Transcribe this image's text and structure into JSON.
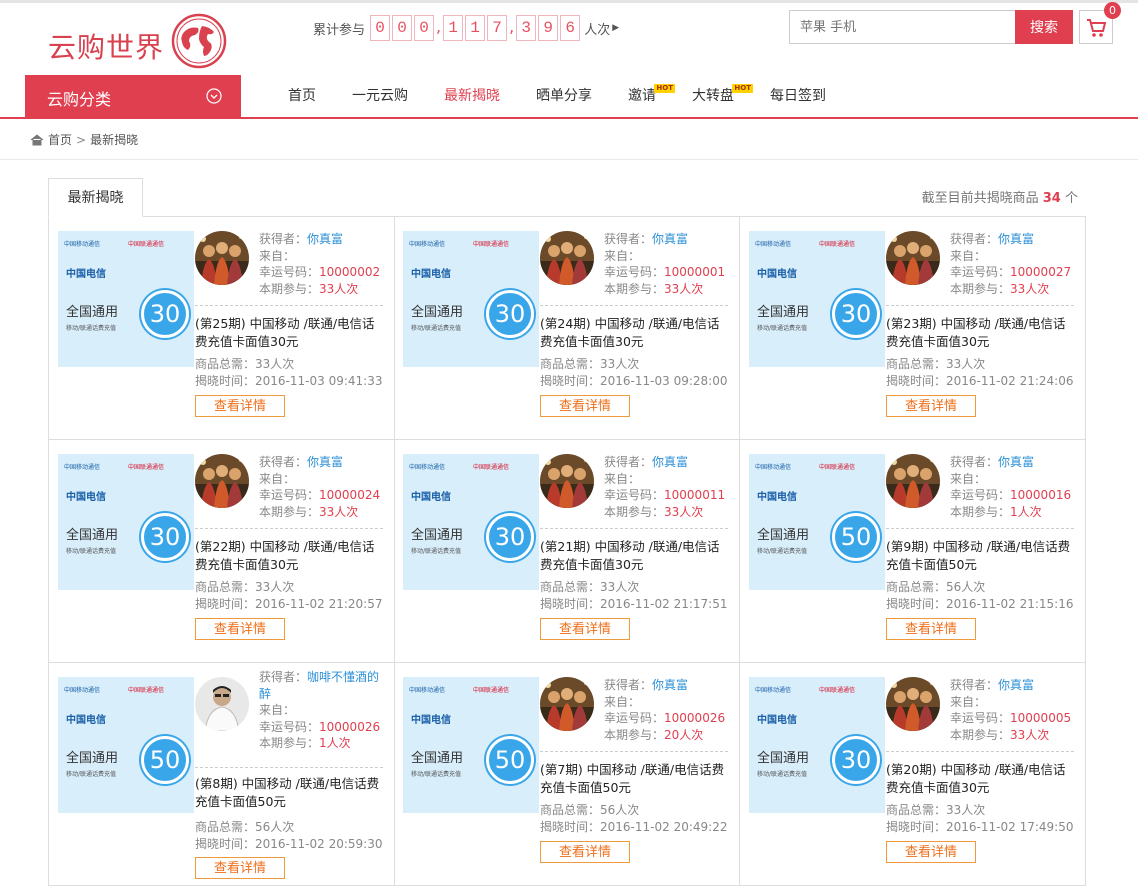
{
  "logo": {
    "text": "云购世界"
  },
  "counter": {
    "label": "累计参与",
    "digits": [
      "0",
      "0",
      "0",
      ",",
      "1",
      "1",
      "7",
      ",",
      "3",
      "9",
      "6"
    ],
    "unit": "人次"
  },
  "search": {
    "placeholder": "苹果 手机",
    "button": "搜索"
  },
  "cart": {
    "count": "0"
  },
  "category": {
    "label": "云购分类"
  },
  "nav": [
    {
      "label": "首页",
      "active": false,
      "hot": ""
    },
    {
      "label": "一元云购",
      "active": false,
      "hot": ""
    },
    {
      "label": "最新揭晓",
      "active": true,
      "hot": ""
    },
    {
      "label": "晒单分享",
      "active": false,
      "hot": ""
    },
    {
      "label": "邀请",
      "active": false,
      "hot": "HOT"
    },
    {
      "label": "大转盘",
      "active": false,
      "hot": "HOT"
    },
    {
      "label": "每日签到",
      "active": false,
      "hot": ""
    }
  ],
  "breadcrumb": {
    "home": "首页",
    "current": "最新揭晓"
  },
  "tab": {
    "label": "最新揭晓"
  },
  "total": {
    "prefix": "截至目前共揭晓商品",
    "count": "34",
    "suffix": "个"
  },
  "product_card": {
    "brand_mobile": "中国移动通信",
    "brand_unicom": "中国联通通信",
    "brand_telecom": "中国电信",
    "tag": "全国通用",
    "sub": "移动/联通话费充值"
  },
  "labels": {
    "winner": "获得者：",
    "from": "来自：",
    "lucky": "幸运号码：",
    "joined": "本期参与：",
    "total_need": "商品总需：",
    "reveal_time": "揭晓时间：",
    "detail_button": "查看详情"
  },
  "items": [
    {
      "value": "30",
      "avatar": "group",
      "winner": "你真富",
      "from": "",
      "lucky": "10000002",
      "joined": "33人次",
      "title": "(第25期) 中国移动 /联通/电信话费充值卡面值30元",
      "total_need": "33人次",
      "time": "2016-11-03 09:41:33"
    },
    {
      "value": "30",
      "avatar": "group",
      "winner": "你真富",
      "from": "",
      "lucky": "10000001",
      "joined": "33人次",
      "title": "(第24期) 中国移动 /联通/电信话费充值卡面值30元",
      "total_need": "33人次",
      "time": "2016-11-03 09:28:00"
    },
    {
      "value": "30",
      "avatar": "group",
      "winner": "你真富",
      "from": "",
      "lucky": "10000027",
      "joined": "33人次",
      "title": "(第23期) 中国移动 /联通/电信话费充值卡面值30元",
      "total_need": "33人次",
      "time": "2016-11-02 21:24:06"
    },
    {
      "value": "30",
      "avatar": "group",
      "winner": "你真富",
      "from": "",
      "lucky": "10000024",
      "joined": "33人次",
      "title": "(第22期) 中国移动 /联通/电信话费充值卡面值30元",
      "total_need": "33人次",
      "time": "2016-11-02 21:20:57"
    },
    {
      "value": "30",
      "avatar": "group",
      "winner": "你真富",
      "from": "",
      "lucky": "10000011",
      "joined": "33人次",
      "title": "(第21期) 中国移动 /联通/电信话费充值卡面值30元",
      "total_need": "33人次",
      "time": "2016-11-02 21:17:51"
    },
    {
      "value": "50",
      "avatar": "group",
      "winner": "你真富",
      "from": "",
      "lucky": "10000016",
      "joined": "1人次",
      "title": "(第9期) 中国移动 /联通/电信话费充值卡面值50元",
      "total_need": "56人次",
      "time": "2016-11-02 21:15:16"
    },
    {
      "value": "50",
      "avatar": "person",
      "winner": "咖啡不懂酒的醉",
      "from": "",
      "lucky": "10000026",
      "joined": "1人次",
      "title": "(第8期) 中国移动 /联通/电信话费充值卡面值50元",
      "total_need": "56人次",
      "time": "2016-11-02 20:59:30"
    },
    {
      "value": "50",
      "avatar": "group",
      "winner": "你真富",
      "from": "",
      "lucky": "10000026",
      "joined": "20人次",
      "title": "(第7期) 中国移动 /联通/电信话费充值卡面值50元",
      "total_need": "56人次",
      "time": "2016-11-02 20:49:22"
    },
    {
      "value": "30",
      "avatar": "group",
      "winner": "你真富",
      "from": "",
      "lucky": "10000005",
      "joined": "33人次",
      "title": "(第20期) 中国移动 /联通/电信话费充值卡面值30元",
      "total_need": "33人次",
      "time": "2016-11-02 17:49:50"
    }
  ]
}
